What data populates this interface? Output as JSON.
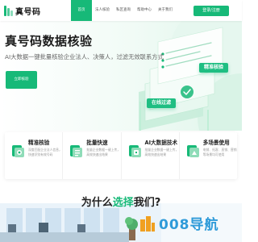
{
  "nav": {
    "logo_text": "真号码",
    "menu": [
      "首页",
      "法人核验",
      "私区查询",
      "帮助中心",
      "关于我们"
    ],
    "active_index": 0,
    "login_label": "登录/注册"
  },
  "hero": {
    "title": "真号码数据核验",
    "subtitle": "AI大数据一键批量核验企业法人、决策人，过滤无效联系方式",
    "cta_label": "立即核验",
    "tags": [
      "精准核验",
      "在线过滤"
    ]
  },
  "features": [
    {
      "icon": "target-icon",
      "title": "精准核验",
      "desc": "深度匹配企业法人信息，快速识别有效号码"
    },
    {
      "icon": "batch-icon",
      "title": "批量快速",
      "desc": "批量企业数据一键上传，高效快速出结果"
    },
    {
      "icon": "ai-icon",
      "title": "AI大数据技术",
      "desc": "批量企业数据一键上传，高效快速出结果"
    },
    {
      "icon": "scene-icon",
      "title": "多场景使用",
      "desc": "电销、拓客、直销、营销等场景均可使用"
    }
  ],
  "bottom": {
    "title_before": "为什么",
    "title_highlight": "选择",
    "title_after": "我们?"
  },
  "watermark": {
    "text": "008导航"
  },
  "colors": {
    "brand": "#17b978",
    "watermark": "#2f9bd9"
  }
}
